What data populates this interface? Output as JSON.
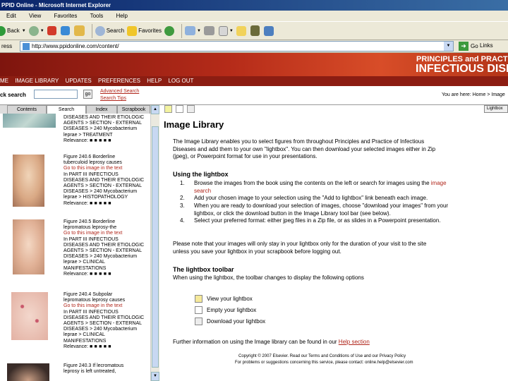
{
  "window": {
    "title": "PPID Online - Microsoft Internet Explorer"
  },
  "menu": [
    "Edit",
    "View",
    "Favorites",
    "Tools",
    "Help"
  ],
  "toolbar": {
    "back_label": "Back",
    "search_label": "Search",
    "favorites_label": "Favorites"
  },
  "address": {
    "label": "ress",
    "url": "http://www.ppidonline.com/content/",
    "go_label": "Go",
    "links_label": "Links"
  },
  "banner": {
    "line1": "PRINCIPLES and PRACTIC",
    "line2": "INFECTIOUS DISEA"
  },
  "nav": [
    "ME",
    "IMAGE LIBRARY",
    "UPDATES",
    "PREFERENCES",
    "HELP",
    "LOG OUT"
  ],
  "search": {
    "label": "ck search",
    "go": "go",
    "advanced": "Advanced Search",
    "tips": "Search Tips",
    "breadcrumb": "You are here: Home > Image"
  },
  "tabs": [
    "Contents",
    "Search",
    "Index",
    "Scrapbook"
  ],
  "library_items": [
    {
      "lines": [
        "DISEASES AND THEIR ETIOLOGIC",
        "AGENTS > SECTION - EXTERNAL",
        "DISEASES > 240 Mycobacterium",
        "leprae > TREATMENT"
      ],
      "relevance_label": "Relevance:",
      "relevance": "■ ■ ■ ■ ■"
    },
    {
      "lines": [
        "Figure 240.6 Borderline",
        "tuberculoid leprosy causes",
        "Go to this image in the text",
        "In PART III INFECTIOUS",
        "DISEASES AND THEIR ETIOLOGIC",
        "AGENTS > SECTION - EXTERNAL",
        "DISEASES > 240 Mycobacterium",
        "leprae > HISTOPATHOLOGY"
      ],
      "relevance_label": "Relevance:",
      "relevance": "■ ■ ■ ■ ■"
    },
    {
      "lines": [
        "Figure 240.5 Borderline",
        "lepromatous leprosy-the",
        "Go to this image in the text",
        "In PART III INFECTIOUS",
        "DISEASES AND THEIR ETIOLOGIC",
        "AGENTS > SECTION - EXTERNAL",
        "DISEASES > 240 Mycobacterium",
        "leprae > CLINICAL",
        "MANIFESTATIONS"
      ],
      "relevance_label": "Relevance:",
      "relevance": "■ ■ ■ ■ ■"
    },
    {
      "lines": [
        "Figure 240.4 Subpolar",
        "lepromatous leprosy causes",
        "Go to this image in the text",
        "In PART III INFECTIOUS",
        "DISEASES AND THEIR ETIOLOGIC",
        "AGENTS > SECTION - EXTERNAL",
        "DISEASES > 240 Mycobacterium",
        "leprae > CLINICAL",
        "MANIFESTATIONS"
      ],
      "relevance_label": "Relevance:",
      "relevance": "■ ■ ■ ■ ■"
    },
    {
      "lines": [
        "Figure 240.3 If lecromatous",
        "leprosy is left untreated,"
      ]
    }
  ],
  "right": {
    "lightbox_button": "Lightbox",
    "title": "Image Library",
    "intro_1": "The Image Library enables you to select figures from throughout Principles and Practice of Infectious",
    "intro_2": "Diseases and add them to your own \"lightbox\". You can then download your selected images either in Zip",
    "intro_3": "(jpeg), or Powerpoint format for use in your presentations.",
    "using_heading": "Using the lightbox",
    "steps": [
      {
        "num": "1.",
        "line1": "Browse the images from the book using the contents on the left or search for images using the ",
        "link": "image",
        "line2_link": "search"
      },
      {
        "num": "2.",
        "line1": "Add your chosen image to your selection using the \"Add to lightbox\" link beneath each image."
      },
      {
        "num": "3.",
        "line1": "When you are ready to download your selection of images, choose \"download your images\" from your",
        "line2": "lightbox, or click the download button in the Image Library tool bar (see below)."
      },
      {
        "num": "4.",
        "line1": "Select your preferred format: either jpeg files in a Zip file, or as slides in a Powerpoint presentation."
      }
    ],
    "note_1": "Please note that your images will only stay in your lightbox only for the duration of your visit to the site",
    "note_2": "unless you save your lightbox in your scrapbook before logging out.",
    "toolbar_heading": "The lightbox toolbar",
    "toolbar_desc": "When using the lightbox, the toolbar changes to display the following options",
    "toolbar_items": [
      "View your lightbox",
      "Empty your lightbox",
      "Download your lightbox"
    ],
    "further_pre": "Further information on using the Image library can be found in our ",
    "further_link": "Help section",
    "footer_1": "Copyright © 2007 Elsevier. Read our Terms and Conditions of Use and our Privacy Policy",
    "footer_2": "For problems or suggestions concerning this service, please contact: online.help@elsevier.com"
  },
  "colors": {
    "banner": "#b52b19",
    "nav": "#8c1d12",
    "link": "#b0251a"
  }
}
